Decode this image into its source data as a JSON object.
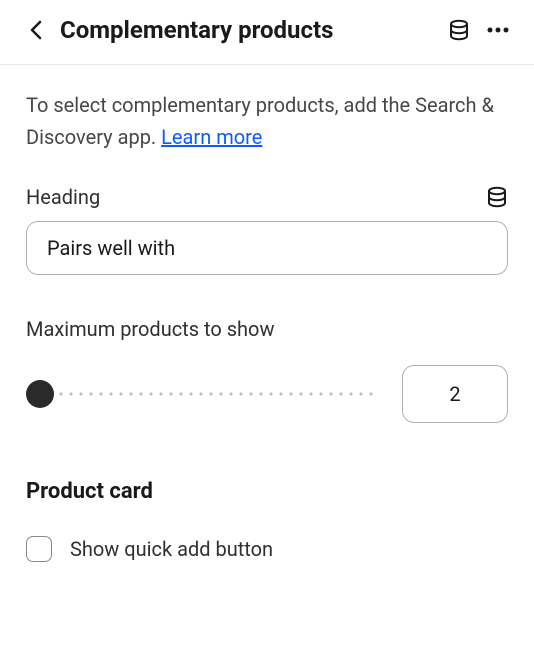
{
  "header": {
    "title": "Complementary products"
  },
  "description": {
    "text": "To select complementary products, add the Search & Discovery app. ",
    "link": "Learn more"
  },
  "heading": {
    "label": "Heading",
    "value": "Pairs well with"
  },
  "maxProducts": {
    "label": "Maximum products to show",
    "value": "2"
  },
  "productCard": {
    "title": "Product card",
    "quickAdd": {
      "label": "Show quick add button",
      "checked": false
    }
  }
}
